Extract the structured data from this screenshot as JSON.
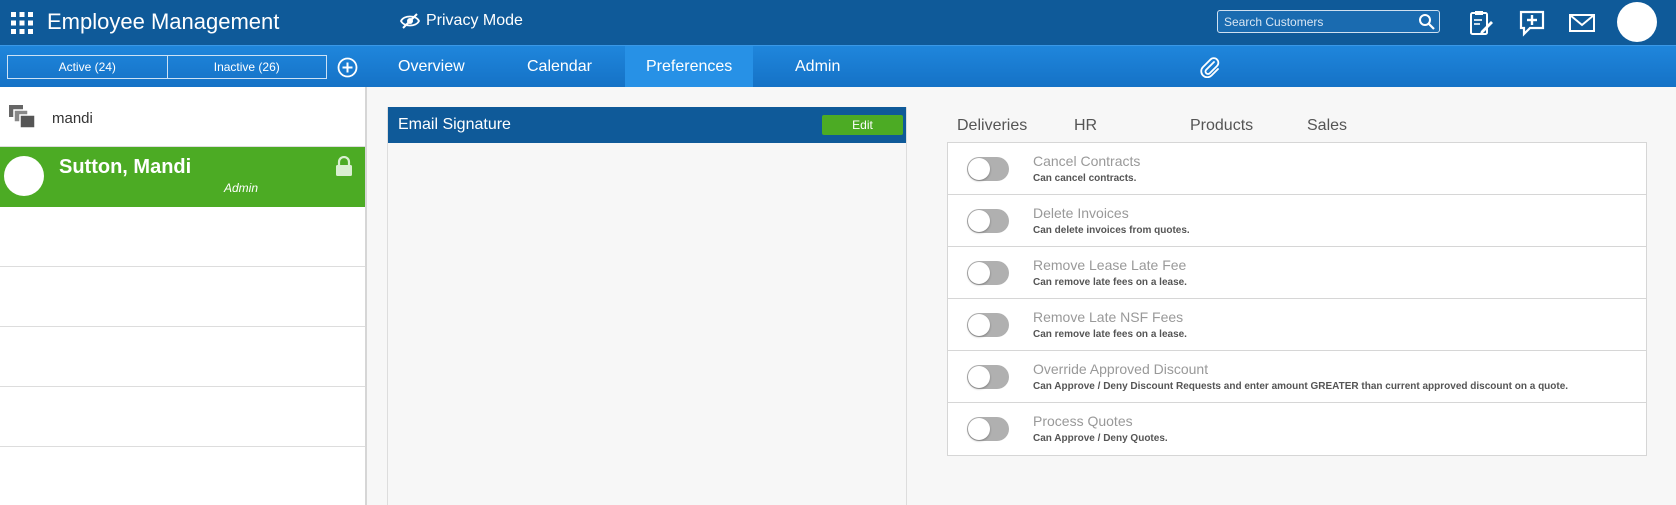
{
  "header": {
    "title": "Employee Management",
    "privacy_label": "Privacy Mode",
    "search_placeholder": "Search Customers"
  },
  "status_tabs": [
    {
      "label": "Active (24)"
    },
    {
      "label": "Inactive (26)"
    }
  ],
  "nav": {
    "tabs": [
      {
        "label": "Overview"
      },
      {
        "label": "Calendar"
      },
      {
        "label": "Preferences",
        "active": true
      },
      {
        "label": "Admin"
      }
    ]
  },
  "sidebar": {
    "filter_text": "mandi",
    "selected_employee": {
      "name": "Sutton, Mandi",
      "role": "Admin"
    }
  },
  "email_signature": {
    "title": "Email Signature",
    "edit_label": "Edit"
  },
  "permissions": {
    "tabs": [
      {
        "label": "Deliveries"
      },
      {
        "label": "HR"
      },
      {
        "label": "Products"
      },
      {
        "label": "Sales"
      }
    ],
    "items": [
      {
        "title": "Cancel Contracts",
        "desc": "Can cancel contracts.",
        "enabled": false
      },
      {
        "title": "Delete Invoices",
        "desc": "Can delete invoices from quotes.",
        "enabled": false
      },
      {
        "title": "Remove Lease Late Fee",
        "desc": "Can remove late fees on a lease.",
        "enabled": false
      },
      {
        "title": "Remove Late NSF Fees",
        "desc": "Can remove late fees on a lease.",
        "enabled": false
      },
      {
        "title": "Override Approved Discount",
        "desc": "Can Approve / Deny Discount Requests and enter amount GREATER than current approved discount on a quote.",
        "enabled": false
      },
      {
        "title": "Process Quotes",
        "desc": "Can Approve / Deny Quotes.",
        "enabled": false
      }
    ]
  },
  "colors": {
    "header_bg": "#0f5a99",
    "nav_bg": "#1a7fd4",
    "accent_green": "#4cab24",
    "toggle_off": "#b0b0b0"
  },
  "icons": {
    "apps": "grid-icon",
    "privacy": "eye-slash-icon",
    "search": "search-icon",
    "notes": "clipboard-edit-icon",
    "add_message": "chat-plus-icon",
    "mail": "envelope-icon",
    "add": "plus-circle-icon",
    "attachment": "paperclip-icon",
    "stack": "stack-icon",
    "lock": "lock-icon"
  }
}
